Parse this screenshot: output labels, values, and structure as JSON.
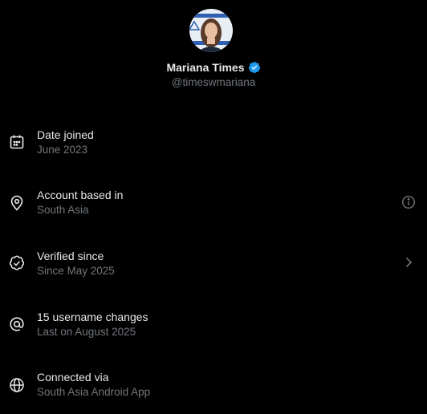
{
  "profile": {
    "display_name": "Mariana Times",
    "handle": "@timeswmariana",
    "verified": true,
    "verified_color": "#1d9bf0"
  },
  "rows": [
    {
      "icon": "calendar-icon",
      "title": "Date joined",
      "subtitle": "June 2023",
      "trailing": ""
    },
    {
      "icon": "location-pin-icon",
      "title": "Account based in",
      "subtitle": "South Asia",
      "trailing": "info-icon"
    },
    {
      "icon": "verified-check-icon",
      "title": "Verified since",
      "subtitle": "Since May 2025",
      "trailing": "chevron-right-icon"
    },
    {
      "icon": "at-sign-icon",
      "title": "15 username changes",
      "subtitle": "Last on August 2025",
      "trailing": ""
    },
    {
      "icon": "globe-icon",
      "title": "Connected via",
      "subtitle": "South Asia Android App",
      "trailing": ""
    }
  ],
  "colors": {
    "background": "#000000",
    "text_primary": "#e7e9ea",
    "text_secondary": "#71767b"
  }
}
